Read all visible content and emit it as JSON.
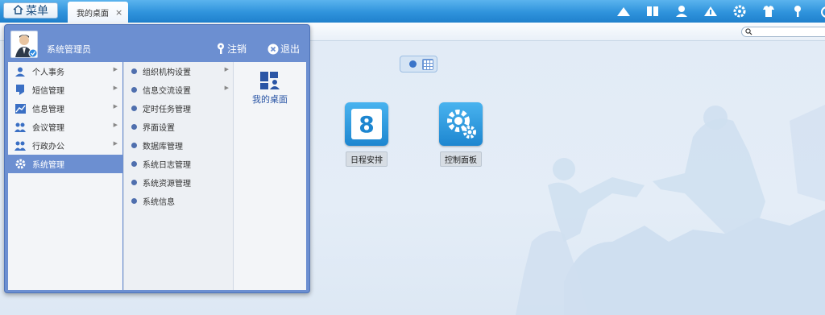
{
  "topbar": {
    "menu_label": "菜单",
    "tab_label": "我的桌面",
    "tab_close": "×",
    "tray_icons": [
      "cloud-icon",
      "book-icon",
      "user-icon",
      "upload-icon",
      "gear-icon",
      "shirt-icon",
      "key-icon",
      "power-icon"
    ]
  },
  "view_toggle": {
    "modes": [
      "dot",
      "grid"
    ],
    "selected": "dot"
  },
  "desktop_apps": [
    {
      "label": "日程安排",
      "icon": "calendar-icon",
      "number": "8"
    },
    {
      "label": "控制面板",
      "icon": "gears-icon"
    }
  ],
  "start_menu": {
    "user_name": "系统管理员",
    "logout_label": "注销",
    "exit_label": "退出",
    "primary": [
      {
        "label": "个人事务",
        "icon": "person-icon"
      },
      {
        "label": "短信管理",
        "icon": "phone-icon"
      },
      {
        "label": "信息管理",
        "icon": "chart-icon"
      },
      {
        "label": "会议管理",
        "icon": "group-icon"
      },
      {
        "label": "行政办公",
        "icon": "office-icon"
      },
      {
        "label": "系统管理",
        "icon": "gear-icon",
        "active": true
      }
    ],
    "secondary": [
      {
        "label": "组织机构设置",
        "has_sub": true
      },
      {
        "label": "信息交流设置",
        "has_sub": true
      },
      {
        "label": "定时任务管理"
      },
      {
        "label": "界面设置"
      },
      {
        "label": "数据库管理"
      },
      {
        "label": "系统日志管理"
      },
      {
        "label": "系统资源管理"
      },
      {
        "label": "系统信息"
      }
    ],
    "shortcut_label": "我的桌面"
  },
  "colors": {
    "accent": "#6c8fd1",
    "topbar": "#2f93dc",
    "desktop_bg": "#e3ecf6"
  }
}
